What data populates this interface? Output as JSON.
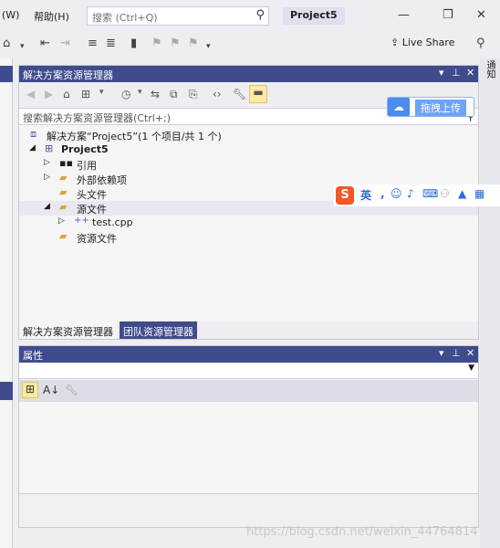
{
  "menu": {
    "window_label": "(W)",
    "help_label": "帮助(H)"
  },
  "search": {
    "placeholder": "搜索 (Ctrl+Q)"
  },
  "title": {
    "project": "Project5"
  },
  "toolbar": {
    "live_share": "Live Share"
  },
  "solution_explorer": {
    "title": "解决方案资源管理器",
    "search_placeholder": "搜索解决方案资源管理器(Ctrl+;)",
    "tree": [
      {
        "label": "解决方案“Project5”(1 个项目/共 1 个)",
        "icon": "solution-icon",
        "arrow": ""
      },
      {
        "label": "Project5",
        "icon": "project-icon",
        "arrow": "◢"
      },
      {
        "label": "引用",
        "icon": "references-icon",
        "arrow": "▷"
      },
      {
        "label": "外部依赖项",
        "icon": "folder-icon",
        "arrow": "▷"
      },
      {
        "label": "头文件",
        "icon": "filter-folder-icon",
        "arrow": ""
      },
      {
        "label": "源文件",
        "icon": "filter-folder-icon",
        "arrow": "◢"
      },
      {
        "label": "test.cpp",
        "icon": "cpp-file-icon",
        "arrow": "▷"
      },
      {
        "label": "资源文件",
        "icon": "filter-folder-icon",
        "arrow": ""
      }
    ],
    "tab_active": "解决方案资源管理器",
    "tab_inactive": "团队资源管理器"
  },
  "upload_widget": {
    "label": "拖拽上传"
  },
  "ime": {
    "logo": "S",
    "lang": "英"
  },
  "right_tab": {
    "label": "通知"
  },
  "properties": {
    "title": "属性"
  },
  "watermark": "https://blog.csdn.net/weixin_44764814",
  "colors": {
    "accent": "#3f4b8c",
    "background": "#eeeef2",
    "selection": "#e8e8ee"
  }
}
